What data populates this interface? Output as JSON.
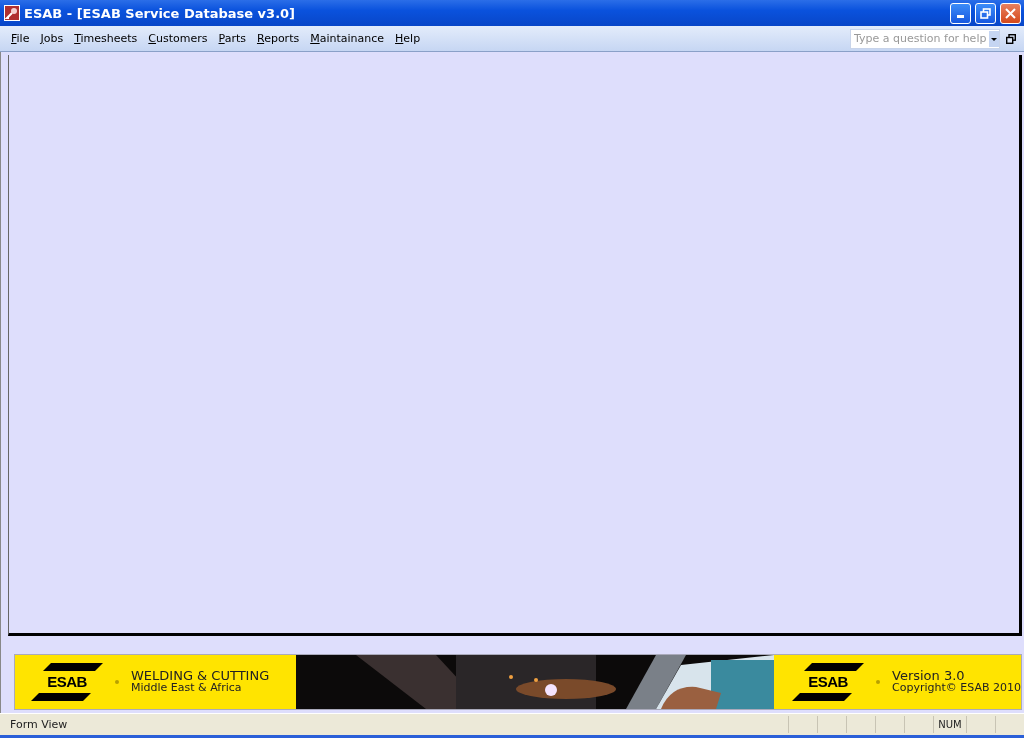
{
  "window": {
    "title": "ESAB - [ESAB Service Database v3.0]"
  },
  "menu": [
    {
      "label": "File"
    },
    {
      "label": "Jobs"
    },
    {
      "label": "Timesheets"
    },
    {
      "label": "Customers"
    },
    {
      "label": "Parts"
    },
    {
      "label": "Reports"
    },
    {
      "label": "Maintainance"
    },
    {
      "label": "Help"
    }
  ],
  "help_box": {
    "placeholder": "Type a question for help"
  },
  "banner": {
    "left": {
      "logo": "ESAB",
      "title": "WELDING & CUTTING",
      "subtitle": "Middle East & Africa"
    },
    "right": {
      "logo": "ESAB",
      "version": "Version 3.0",
      "copyright": "Copyright© ESAB 2010"
    }
  },
  "status_bar": {
    "text": "Form View",
    "indicator": "NUM"
  }
}
